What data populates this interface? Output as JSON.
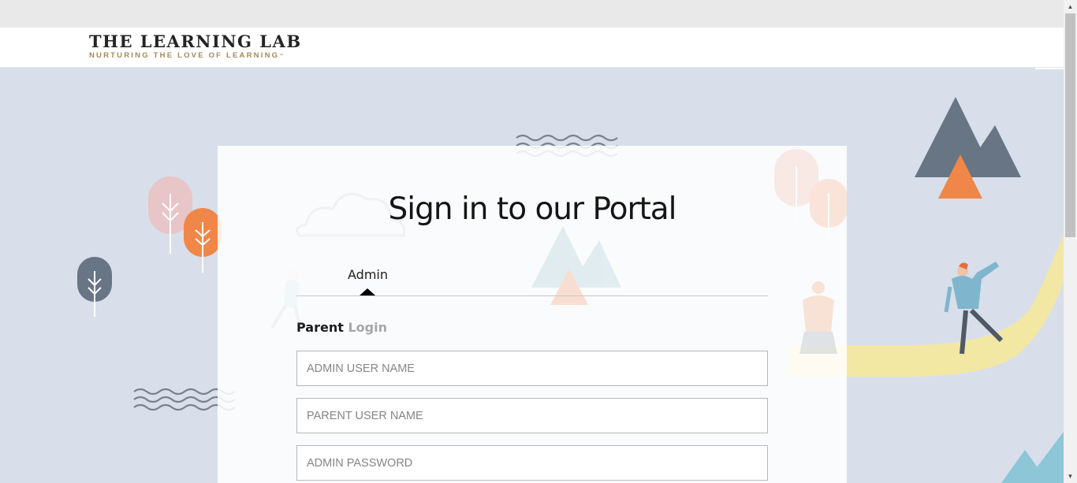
{
  "header": {
    "logo_title": "THE LEARNING LAB",
    "logo_tagline": "NURTURING THE LOVE OF LEARNING",
    "logo_tm": "™"
  },
  "login": {
    "title": "Sign in to our Portal",
    "tab_label": "Admin",
    "heading_strong": "Parent",
    "heading_light": "Login",
    "fields": [
      {
        "placeholder": "ADMIN USER NAME"
      },
      {
        "placeholder": "PARENT USER NAME"
      },
      {
        "placeholder": "ADMIN PASSWORD"
      }
    ]
  },
  "colors": {
    "background": "#d8dfea",
    "brand_gold": "#a38a5b",
    "mountain_slate": "#687584",
    "accent_orange": "#f08748",
    "path_yellow": "#f3e7a4",
    "figure_blue": "#7fb6cd"
  },
  "icons": [
    "scroll-up-arrow-icon",
    "scroll-down-arrow-icon"
  ]
}
